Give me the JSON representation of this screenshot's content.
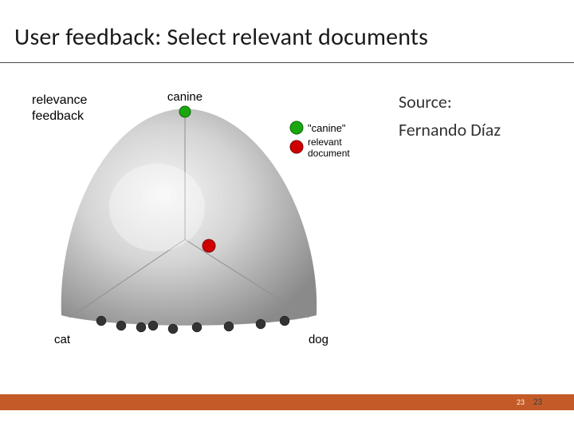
{
  "title": "User feedback: Select relevant documents",
  "source": {
    "label": "Source:",
    "name": "Fernando Díaz"
  },
  "figure": {
    "heading_line1": "relevance",
    "heading_line2": "feedback",
    "axis_top": "canine",
    "axis_left": "cat",
    "axis_right": "dog",
    "legend": {
      "query_label": "\"canine\"",
      "relevant_label_line1": "relevant",
      "relevant_label_line2": "document"
    },
    "colors": {
      "query_dot": "#1aa60f",
      "relevant_dot": "#d00000",
      "other_dot": "#333333",
      "sphere_light": "#eeeeee",
      "sphere_mid": "#bfbfbf",
      "sphere_dark": "#8f8f8f"
    }
  },
  "page_number": "23"
}
